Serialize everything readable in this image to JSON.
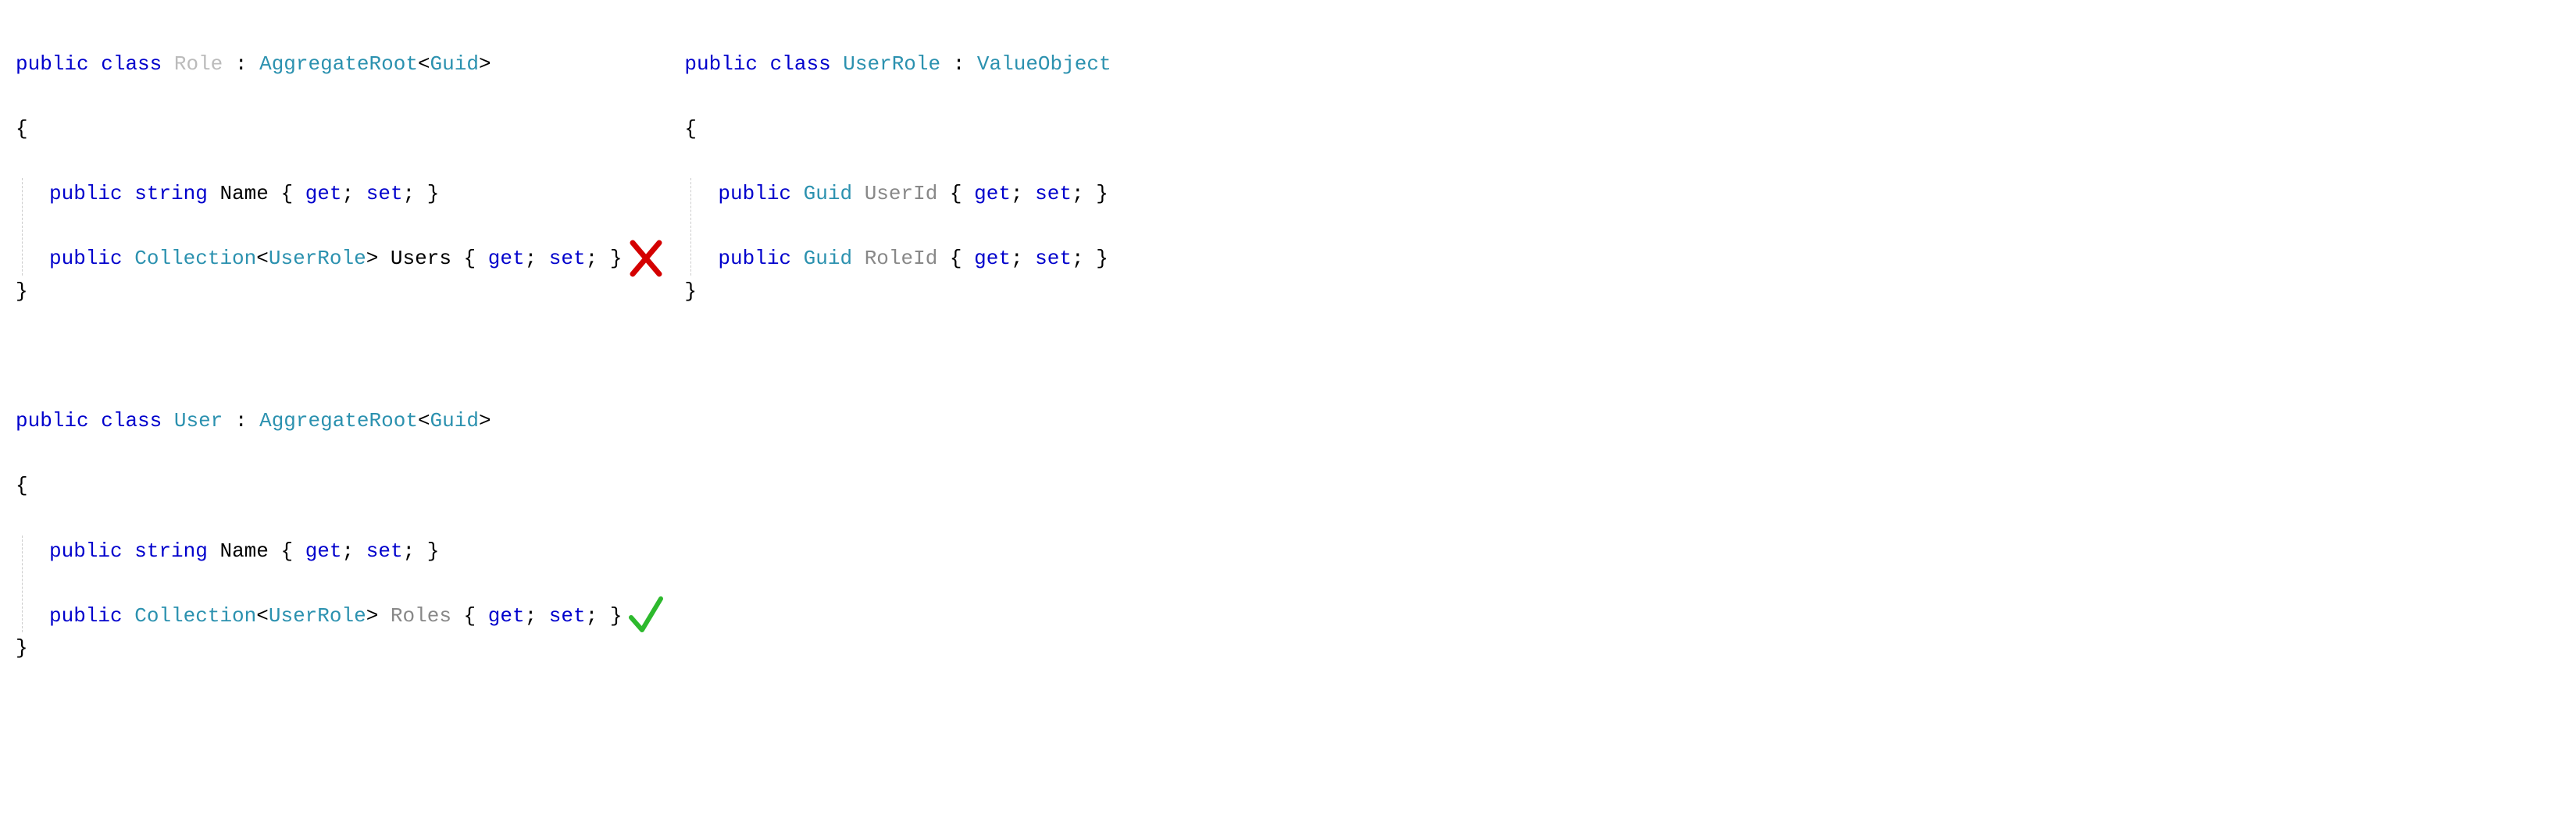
{
  "left": {
    "role": {
      "decl_public": "public",
      "decl_class": "class",
      "name": "Role",
      "colon": " : ",
      "base": "AggregateRoot",
      "lt": "<",
      "gt": ">",
      "type_param": "Guid",
      "open_brace": "{",
      "close_brace": "}",
      "prop1": {
        "public": "public",
        "type": "string",
        "name": "Name",
        "accessors": " { ",
        "get": "get",
        "semi1": "; ",
        "set": "set",
        "semi2": "; ",
        "close": "}"
      },
      "prop2": {
        "public": "public",
        "type": "Collection",
        "lt": "<",
        "inner": "UserRole",
        "gt": ">",
        "name": "Users",
        "accessors": " { ",
        "get": "get",
        "semi1": "; ",
        "set": "set",
        "semi2": "; ",
        "close": "}"
      }
    },
    "user": {
      "decl_public": "public",
      "decl_class": "class",
      "name": "User",
      "colon": " : ",
      "base": "AggregateRoot",
      "lt": "<",
      "gt": ">",
      "type_param": "Guid",
      "open_brace": "{",
      "close_brace": "}",
      "prop1": {
        "public": "public",
        "type": "string",
        "name": "Name",
        "accessors": " { ",
        "get": "get",
        "semi1": "; ",
        "set": "set",
        "semi2": "; ",
        "close": "}"
      },
      "prop2": {
        "public": "public",
        "type": "Collection",
        "lt": "<",
        "inner": "UserRole",
        "gt": ">",
        "name": "Roles",
        "accessors": " { ",
        "get": "get",
        "semi1": "; ",
        "set": "set",
        "semi2": "; ",
        "close": "}"
      }
    }
  },
  "right": {
    "userrole": {
      "decl_public": "public",
      "decl_class": "class",
      "name": "UserRole",
      "colon": " : ",
      "base": "ValueObject",
      "open_brace": "{",
      "close_brace": "}",
      "prop1": {
        "public": "public",
        "type": "Guid",
        "name": "UserId",
        "accessors": " { ",
        "get": "get",
        "semi1": "; ",
        "set": "set",
        "semi2": "; ",
        "close": "}"
      },
      "prop2": {
        "public": "public",
        "type": "Guid",
        "name": "RoleId",
        "accessors": " { ",
        "get": "get",
        "semi1": "; ",
        "set": "set",
        "semi2": "; ",
        "close": "}"
      }
    }
  },
  "marks": {
    "cross_color": "#d40000",
    "check_color": "#2db92d"
  }
}
